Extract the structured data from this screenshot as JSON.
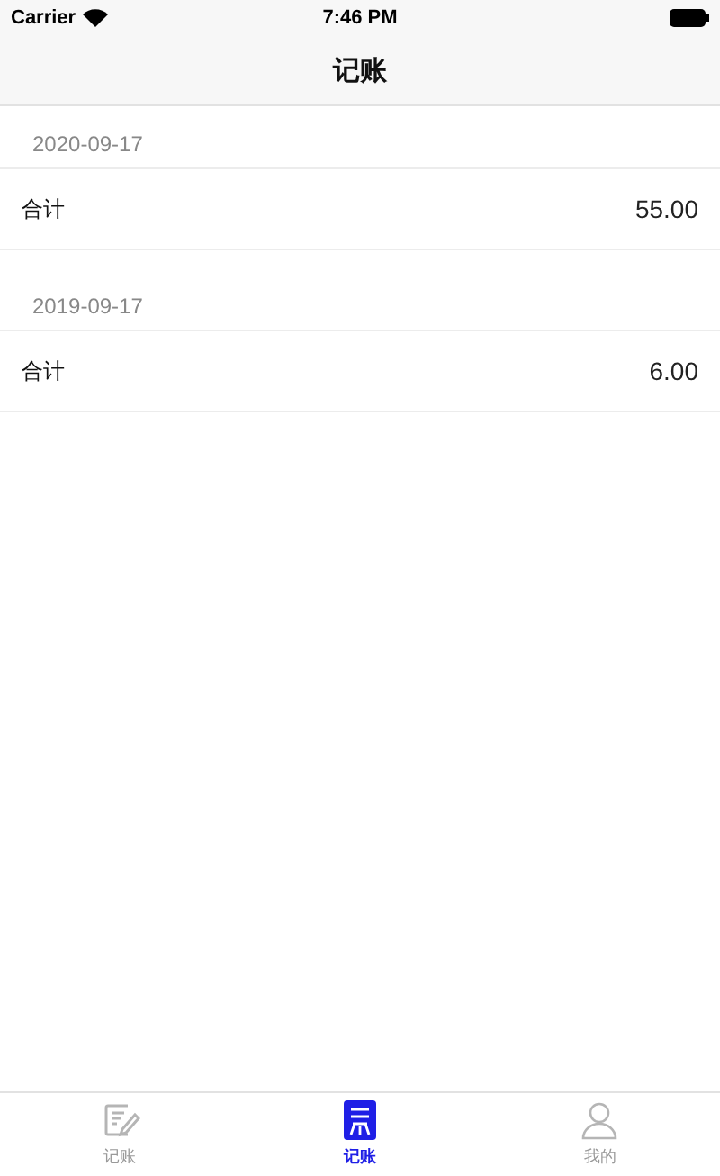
{
  "status_bar": {
    "carrier": "Carrier",
    "time": "7:46 PM"
  },
  "nav": {
    "title": "记账"
  },
  "sections": [
    {
      "date": "2020-09-17",
      "rows": [
        {
          "label": "合计",
          "value": "55.00"
        }
      ]
    },
    {
      "date": "2019-09-17",
      "rows": [
        {
          "label": "合计",
          "value": "6.00"
        }
      ]
    }
  ],
  "tabs": [
    {
      "label": "记账",
      "kind": "note",
      "selected": false
    },
    {
      "label": "记账",
      "kind": "list",
      "selected": true
    },
    {
      "label": "我的",
      "kind": "person",
      "selected": false
    }
  ]
}
